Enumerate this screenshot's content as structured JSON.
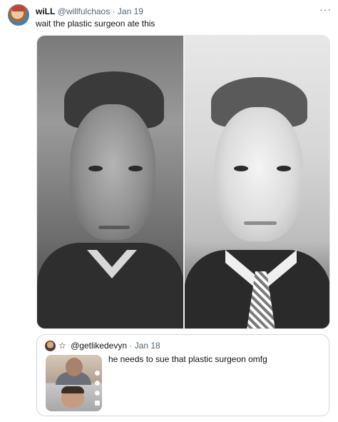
{
  "tweet": {
    "author_name": "wiLL",
    "author_handle": "@willfulchaos",
    "separator": "·",
    "date": "Jan 19",
    "more_label": "···",
    "text": "wait the plastic surgeon ate this"
  },
  "quoted": {
    "star": "☆",
    "handle": "@getlikedevyn",
    "separator": "·",
    "date": "Jan 18",
    "text": "he needs to sue that plastic surgeon omfg"
  },
  "colors": {
    "text_primary": "#0f1419",
    "text_secondary": "#536471",
    "border": "#cfd9de"
  }
}
